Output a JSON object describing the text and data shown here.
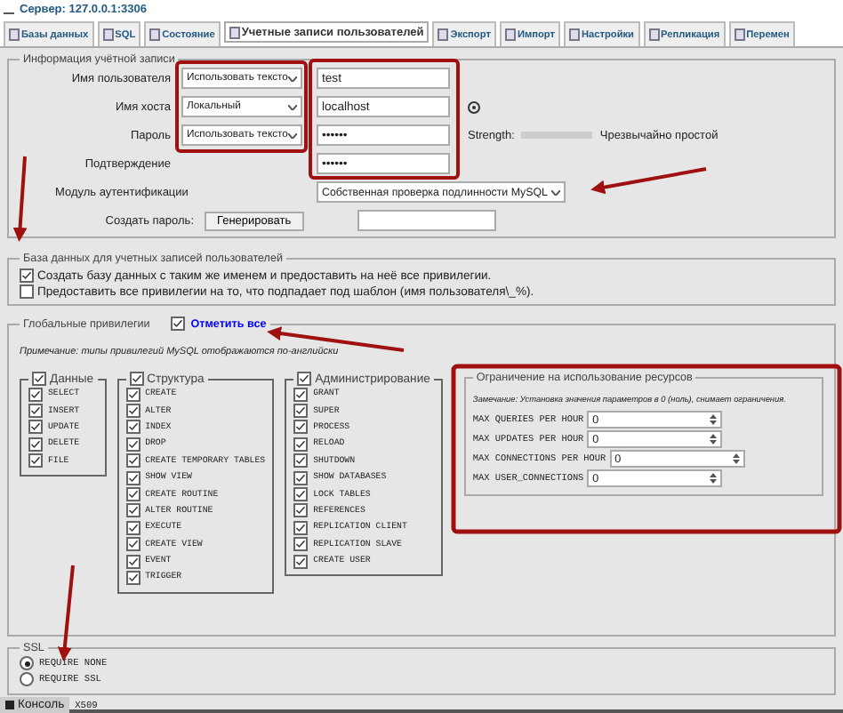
{
  "server": "Сервер: 127.0.0.1:3306",
  "tabs": [
    {
      "label": "Базы данных",
      "selected": false
    },
    {
      "label": "SQL",
      "selected": false
    },
    {
      "label": "Состояние",
      "selected": false
    },
    {
      "label": "Учетные записи пользователей",
      "selected": true
    },
    {
      "label": "Экспорт",
      "selected": false
    },
    {
      "label": "Импорт",
      "selected": false
    },
    {
      "label": "Настройки",
      "selected": false
    },
    {
      "label": "Репликация",
      "selected": false
    },
    {
      "label": "Перемен",
      "selected": false
    }
  ],
  "account": {
    "legend": "Информация учётной записи",
    "fields": [
      {
        "label": "Имя пользователя",
        "mode": "Использовать тексто",
        "value": "test"
      },
      {
        "label": "Имя хоста",
        "mode": "Локальный",
        "value": "localhost",
        "help": true
      },
      {
        "label": "Пароль",
        "mode": "Использовать тексто",
        "value": "••••••",
        "strength_label": "Strength:",
        "strength": "Чрезвычайно простой"
      },
      {
        "label": "Подтверждение",
        "value": "••••••"
      }
    ],
    "auth": {
      "label": "Модуль аутентификации",
      "value": "Собственная проверка подлинности MySQL"
    },
    "generate": {
      "label": "Создать пароль:",
      "button": "Генерировать"
    }
  },
  "database": {
    "legend": "База данных для учетных записей пользователей",
    "options": [
      {
        "label": "Создать базу данных с таким же именем и предоставить на неё все привилегии.",
        "checked": true
      },
      {
        "label": "Предоставить все привилегии на то, что подпадает под шаблон (имя пользователя\\_%).",
        "checked": false
      }
    ]
  },
  "privileges": {
    "legend": "Глобальные привилегии",
    "check_all": {
      "label": "Отметить все",
      "checked": true
    },
    "note": "Примечание: типы привилегий MySQL отображаются по-английски",
    "groups": [
      {
        "name": "Данные",
        "checked": true,
        "items": [
          {
            "label": "SELECT",
            "checked": true
          },
          {
            "label": "INSERT",
            "checked": true
          },
          {
            "label": "UPDATE",
            "checked": true
          },
          {
            "label": "DELETE",
            "checked": true
          },
          {
            "label": "FILE",
            "checked": true
          }
        ]
      },
      {
        "name": "Структура",
        "checked": true,
        "items": [
          {
            "label": "CREATE",
            "checked": true
          },
          {
            "label": "ALTER",
            "checked": true
          },
          {
            "label": "INDEX",
            "checked": true
          },
          {
            "label": "DROP",
            "checked": true
          },
          {
            "label": "CREATE TEMPORARY TABLES",
            "checked": true
          },
          {
            "label": "SHOW VIEW",
            "checked": true
          },
          {
            "label": "CREATE ROUTINE",
            "checked": true
          },
          {
            "label": "ALTER ROUTINE",
            "checked": true
          },
          {
            "label": "EXECUTE",
            "checked": true
          },
          {
            "label": "CREATE VIEW",
            "checked": true
          },
          {
            "label": "EVENT",
            "checked": true
          },
          {
            "label": "TRIGGER",
            "checked": true
          }
        ]
      },
      {
        "name": "Администрирование",
        "checked": true,
        "items": [
          {
            "label": "GRANT",
            "checked": true
          },
          {
            "label": "SUPER",
            "checked": true
          },
          {
            "label": "PROCESS",
            "checked": true
          },
          {
            "label": "RELOAD",
            "checked": true
          },
          {
            "label": "SHUTDOWN",
            "checked": true
          },
          {
            "label": "SHOW DATABASES",
            "checked": true
          },
          {
            "label": "LOCK TABLES",
            "checked": true
          },
          {
            "label": "REFERENCES",
            "checked": true
          },
          {
            "label": "REPLICATION CLIENT",
            "checked": true
          },
          {
            "label": "REPLICATION SLAVE",
            "checked": true
          },
          {
            "label": "CREATE USER",
            "checked": true
          }
        ]
      }
    ],
    "limits": {
      "legend": "Ограничение на использование ресурсов",
      "note": "Замечание: Установка значения параметров в 0 (ноль), снимает ограничения.",
      "fields": [
        {
          "label": "MAX QUERIES PER HOUR",
          "value": "0"
        },
        {
          "label": "MAX UPDATES PER HOUR",
          "value": "0"
        },
        {
          "label": "MAX CONNECTIONS PER HOUR",
          "value": "0"
        },
        {
          "label": "MAX USER_CONNECTIONS",
          "value": "0"
        }
      ]
    }
  },
  "ssl": {
    "legend": "SSL",
    "options": [
      {
        "label": "REQUIRE NONE",
        "selected": true
      },
      {
        "label": "REQUIRE SSL",
        "selected": false
      }
    ]
  },
  "console": {
    "label": "Консоль",
    "trailing": "X509"
  }
}
